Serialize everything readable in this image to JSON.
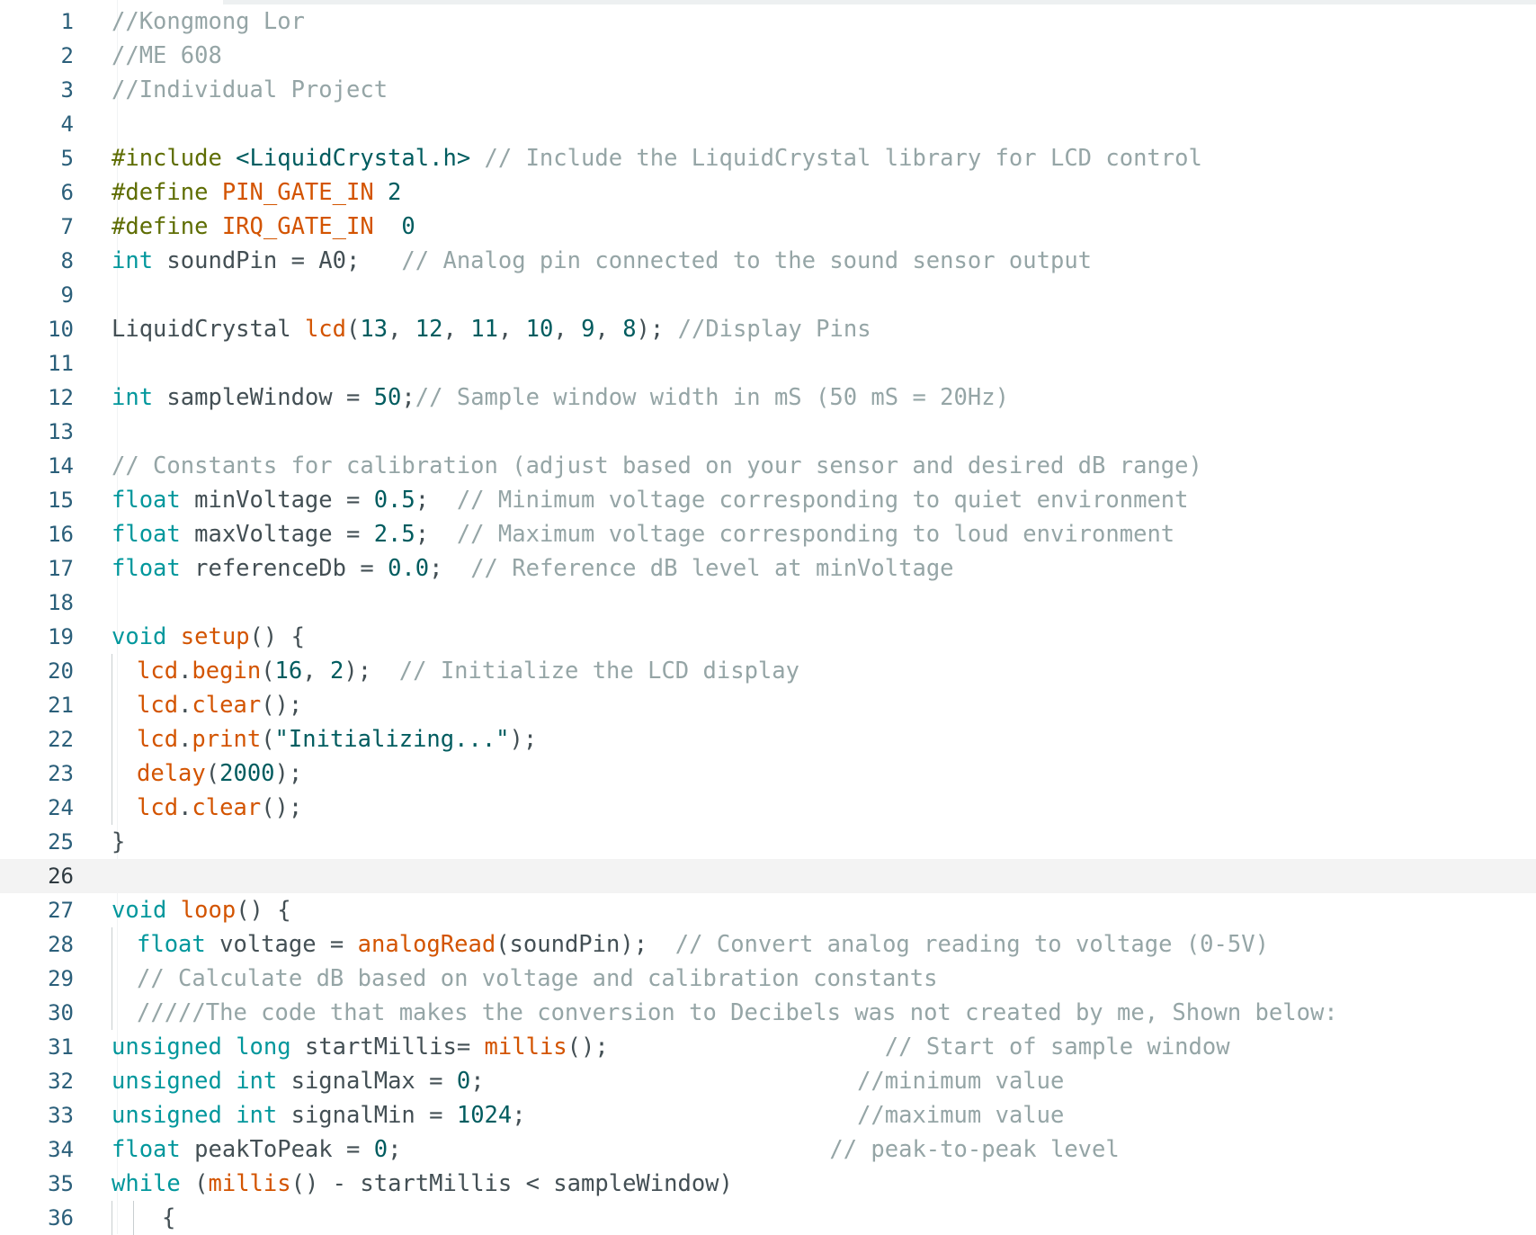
{
  "editor": {
    "colors": {
      "keyword": "#00979c",
      "preprocessor": "#5e6d03",
      "function": "#d35400",
      "comment": "#95a5a6",
      "number": "#005c5f",
      "text": "#434f54",
      "line_number": "#2b5f7a",
      "current_line_bg": "#f3f3f3"
    },
    "current_line": 26,
    "lines": [
      {
        "number": "1",
        "indent": 0,
        "tokens": [
          {
            "t": "//Kongmong Lor",
            "c": "cm"
          }
        ]
      },
      {
        "number": "2",
        "indent": 0,
        "tokens": [
          {
            "t": "//ME 608",
            "c": "cm"
          }
        ]
      },
      {
        "number": "3",
        "indent": 0,
        "tokens": [
          {
            "t": "//Individual Project",
            "c": "cm"
          }
        ]
      },
      {
        "number": "4",
        "indent": 0,
        "tokens": []
      },
      {
        "number": "5",
        "indent": 0,
        "tokens": [
          {
            "t": "#include",
            "c": "pp"
          },
          {
            "t": " <LiquidCrystal.h>",
            "c": "str"
          },
          {
            "t": " // Include the LiquidCrystal library for LCD control",
            "c": "cm"
          }
        ]
      },
      {
        "number": "6",
        "indent": 0,
        "tokens": [
          {
            "t": "#define",
            "c": "pp"
          },
          {
            "t": " PIN_GATE_IN",
            "c": "fn"
          },
          {
            "t": " 2",
            "c": "num"
          }
        ]
      },
      {
        "number": "7",
        "indent": 0,
        "tokens": [
          {
            "t": "#define",
            "c": "pp"
          },
          {
            "t": " IRQ_GATE_IN",
            "c": "fn"
          },
          {
            "t": "  0",
            "c": "num"
          }
        ]
      },
      {
        "number": "8",
        "indent": 0,
        "tokens": [
          {
            "t": "int",
            "c": "kw"
          },
          {
            "t": " soundPin = A0;   ",
            "c": "tx"
          },
          {
            "t": "// Analog pin connected to the sound sensor output",
            "c": "cm"
          }
        ]
      },
      {
        "number": "9",
        "indent": 0,
        "tokens": []
      },
      {
        "number": "10",
        "indent": 0,
        "tokens": [
          {
            "t": "LiquidCrystal ",
            "c": "tx"
          },
          {
            "t": "lcd",
            "c": "fn"
          },
          {
            "t": "(",
            "c": "tx"
          },
          {
            "t": "13",
            "c": "num"
          },
          {
            "t": ", ",
            "c": "tx"
          },
          {
            "t": "12",
            "c": "num"
          },
          {
            "t": ", ",
            "c": "tx"
          },
          {
            "t": "11",
            "c": "num"
          },
          {
            "t": ", ",
            "c": "tx"
          },
          {
            "t": "10",
            "c": "num"
          },
          {
            "t": ", ",
            "c": "tx"
          },
          {
            "t": "9",
            "c": "num"
          },
          {
            "t": ", ",
            "c": "tx"
          },
          {
            "t": "8",
            "c": "num"
          },
          {
            "t": "); ",
            "c": "tx"
          },
          {
            "t": "//Display Pins",
            "c": "cm"
          }
        ]
      },
      {
        "number": "11",
        "indent": 0,
        "tokens": []
      },
      {
        "number": "12",
        "indent": 0,
        "tokens": [
          {
            "t": "int",
            "c": "kw"
          },
          {
            "t": " sampleWindow = ",
            "c": "tx"
          },
          {
            "t": "50",
            "c": "num"
          },
          {
            "t": ";",
            "c": "tx"
          },
          {
            "t": "// Sample window width in mS (50 mS = 20Hz)",
            "c": "cm"
          }
        ]
      },
      {
        "number": "13",
        "indent": 0,
        "tokens": []
      },
      {
        "number": "14",
        "indent": 0,
        "tokens": [
          {
            "t": "// Constants for calibration (adjust based on your sensor and desired dB range)",
            "c": "cm"
          }
        ]
      },
      {
        "number": "15",
        "indent": 0,
        "tokens": [
          {
            "t": "float",
            "c": "kw"
          },
          {
            "t": " minVoltage = ",
            "c": "tx"
          },
          {
            "t": "0.5",
            "c": "num"
          },
          {
            "t": ";  ",
            "c": "tx"
          },
          {
            "t": "// Minimum voltage corresponding to quiet environment",
            "c": "cm"
          }
        ]
      },
      {
        "number": "16",
        "indent": 0,
        "tokens": [
          {
            "t": "float",
            "c": "kw"
          },
          {
            "t": " maxVoltage = ",
            "c": "tx"
          },
          {
            "t": "2.5",
            "c": "num"
          },
          {
            "t": ";  ",
            "c": "tx"
          },
          {
            "t": "// Maximum voltage corresponding to loud environment",
            "c": "cm"
          }
        ]
      },
      {
        "number": "17",
        "indent": 0,
        "tokens": [
          {
            "t": "float",
            "c": "kw"
          },
          {
            "t": " referenceDb = ",
            "c": "tx"
          },
          {
            "t": "0.0",
            "c": "num"
          },
          {
            "t": ";  ",
            "c": "tx"
          },
          {
            "t": "// Reference dB level at minVoltage",
            "c": "cm"
          }
        ]
      },
      {
        "number": "18",
        "indent": 0,
        "tokens": []
      },
      {
        "number": "19",
        "indent": 0,
        "tokens": [
          {
            "t": "void",
            "c": "kw"
          },
          {
            "t": " ",
            "c": "tx"
          },
          {
            "t": "setup",
            "c": "fn"
          },
          {
            "t": "() {",
            "c": "tx"
          }
        ]
      },
      {
        "number": "20",
        "indent": 1,
        "tokens": [
          {
            "t": "lcd",
            "c": "fn"
          },
          {
            "t": ".",
            "c": "tx"
          },
          {
            "t": "begin",
            "c": "fn"
          },
          {
            "t": "(",
            "c": "tx"
          },
          {
            "t": "16",
            "c": "num"
          },
          {
            "t": ", ",
            "c": "tx"
          },
          {
            "t": "2",
            "c": "num"
          },
          {
            "t": ");  ",
            "c": "tx"
          },
          {
            "t": "// Initialize the LCD display",
            "c": "cm"
          }
        ]
      },
      {
        "number": "21",
        "indent": 1,
        "tokens": [
          {
            "t": "lcd",
            "c": "fn"
          },
          {
            "t": ".",
            "c": "tx"
          },
          {
            "t": "clear",
            "c": "fn"
          },
          {
            "t": "();",
            "c": "tx"
          }
        ]
      },
      {
        "number": "22",
        "indent": 1,
        "tokens": [
          {
            "t": "lcd",
            "c": "fn"
          },
          {
            "t": ".",
            "c": "tx"
          },
          {
            "t": "print",
            "c": "fn"
          },
          {
            "t": "(",
            "c": "tx"
          },
          {
            "t": "\"Initializing...\"",
            "c": "str"
          },
          {
            "t": ");",
            "c": "tx"
          }
        ]
      },
      {
        "number": "23",
        "indent": 1,
        "tokens": [
          {
            "t": "delay",
            "c": "fn"
          },
          {
            "t": "(",
            "c": "tx"
          },
          {
            "t": "2000",
            "c": "num"
          },
          {
            "t": ");",
            "c": "tx"
          }
        ]
      },
      {
        "number": "24",
        "indent": 1,
        "tokens": [
          {
            "t": "lcd",
            "c": "fn"
          },
          {
            "t": ".",
            "c": "tx"
          },
          {
            "t": "clear",
            "c": "fn"
          },
          {
            "t": "();",
            "c": "tx"
          }
        ]
      },
      {
        "number": "25",
        "indent": 0,
        "tokens": [
          {
            "t": "}",
            "c": "tx"
          }
        ]
      },
      {
        "number": "26",
        "indent": 0,
        "tokens": []
      },
      {
        "number": "27",
        "indent": 0,
        "tokens": [
          {
            "t": "void",
            "c": "kw"
          },
          {
            "t": " ",
            "c": "tx"
          },
          {
            "t": "loop",
            "c": "fn"
          },
          {
            "t": "() {",
            "c": "tx"
          }
        ]
      },
      {
        "number": "28",
        "indent": 1,
        "tokens": [
          {
            "t": "float",
            "c": "kw"
          },
          {
            "t": " voltage = ",
            "c": "tx"
          },
          {
            "t": "analogRead",
            "c": "fn"
          },
          {
            "t": "(soundPin);  ",
            "c": "tx"
          },
          {
            "t": "// Convert analog reading to voltage (0-5V)",
            "c": "cm"
          }
        ]
      },
      {
        "number": "29",
        "indent": 1,
        "tokens": [
          {
            "t": "// Calculate dB based on voltage and calibration constants",
            "c": "cm"
          }
        ]
      },
      {
        "number": "30",
        "indent": 1,
        "tokens": [
          {
            "t": "/////The code that makes the conversion to Decibels was not created by me, Shown below:",
            "c": "cm"
          }
        ]
      },
      {
        "number": "31",
        "indent": 0,
        "tokens": [
          {
            "t": "unsigned",
            "c": "kw"
          },
          {
            "t": " ",
            "c": "tx"
          },
          {
            "t": "long",
            "c": "kw"
          },
          {
            "t": " startMillis= ",
            "c": "tx"
          },
          {
            "t": "millis",
            "c": "fn"
          },
          {
            "t": "();                    ",
            "c": "tx"
          },
          {
            "t": "// Start of sample window",
            "c": "cm"
          }
        ]
      },
      {
        "number": "32",
        "indent": 0,
        "tokens": [
          {
            "t": "unsigned",
            "c": "kw"
          },
          {
            "t": " ",
            "c": "tx"
          },
          {
            "t": "int",
            "c": "kw"
          },
          {
            "t": " signalMax = ",
            "c": "tx"
          },
          {
            "t": "0",
            "c": "num"
          },
          {
            "t": ";                           ",
            "c": "tx"
          },
          {
            "t": "//minimum value",
            "c": "cm"
          }
        ]
      },
      {
        "number": "33",
        "indent": 0,
        "tokens": [
          {
            "t": "unsigned",
            "c": "kw"
          },
          {
            "t": " ",
            "c": "tx"
          },
          {
            "t": "int",
            "c": "kw"
          },
          {
            "t": " signalMin = ",
            "c": "tx"
          },
          {
            "t": "1024",
            "c": "num"
          },
          {
            "t": ";                        ",
            "c": "tx"
          },
          {
            "t": "//maximum value",
            "c": "cm"
          }
        ]
      },
      {
        "number": "34",
        "indent": 0,
        "tokens": [
          {
            "t": "float",
            "c": "kw"
          },
          {
            "t": " peakToPeak = ",
            "c": "tx"
          },
          {
            "t": "0",
            "c": "num"
          },
          {
            "t": ";                               ",
            "c": "tx"
          },
          {
            "t": "// peak-to-peak level",
            "c": "cm"
          }
        ]
      },
      {
        "number": "35",
        "indent": 0,
        "tokens": [
          {
            "t": "while",
            "c": "kw"
          },
          {
            "t": " (",
            "c": "tx"
          },
          {
            "t": "millis",
            "c": "fn"
          },
          {
            "t": "() - startMillis < sampleWindow)",
            "c": "tx"
          }
        ]
      },
      {
        "number": "36",
        "indent": 2,
        "tokens": [
          {
            "t": "{",
            "c": "tx"
          }
        ]
      }
    ]
  }
}
